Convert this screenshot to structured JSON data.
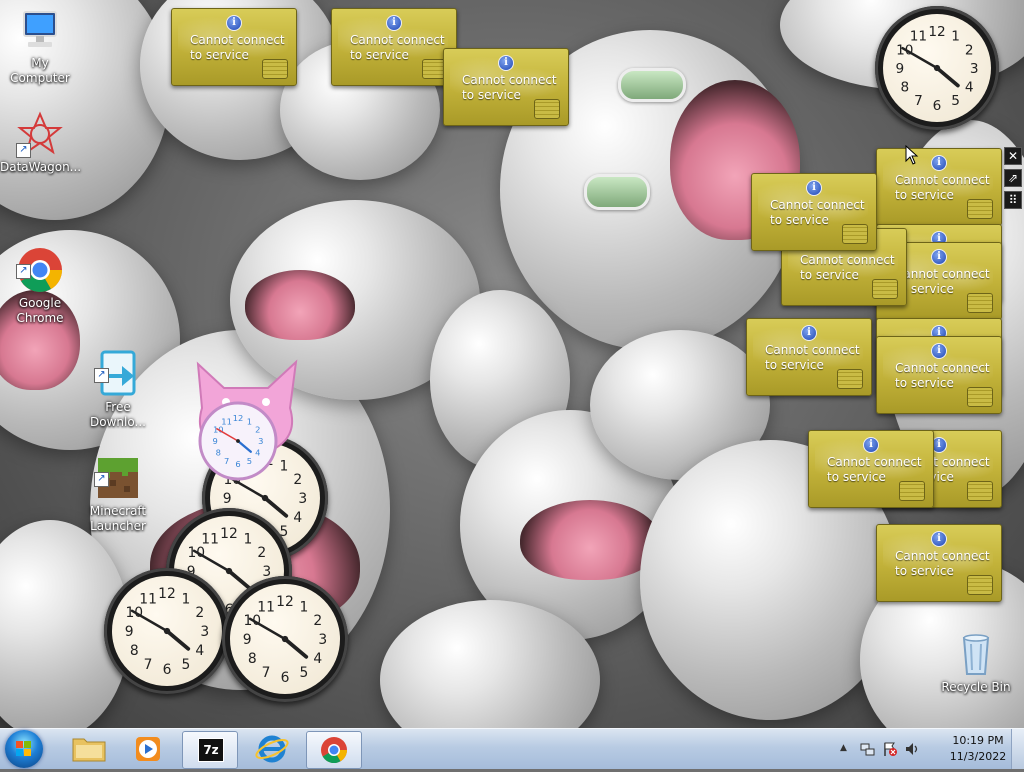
{
  "desktop_icons": [
    {
      "label": "My Computer",
      "icon": "computer-icon"
    },
    {
      "label": "DataWagon...",
      "icon": "datawagon-icon"
    },
    {
      "label": "Google\nChrome",
      "icon": "chrome-icon"
    },
    {
      "label": "Free\nDownlo...",
      "icon": "free-download-icon"
    },
    {
      "label": "Minecraft\nLauncher",
      "icon": "minecraft-icon"
    },
    {
      "label": "Recycle Bin",
      "icon": "recycle-bin-icon"
    }
  ],
  "alert_gadget": {
    "message_line1": "Cannot connect",
    "message_line2": "to service",
    "partial_text_a": "ce",
    "partial_text_b": "service",
    "info_glyph": "i"
  },
  "gadget_toolbar": {
    "close_glyph": "✕",
    "options_glyph": "⇗",
    "drag_glyph": "⠿"
  },
  "clock_numbers": [
    "12",
    "1",
    "2",
    "3",
    "4",
    "5",
    "6",
    "7",
    "8",
    "9",
    "10",
    "11"
  ],
  "taskbar": {
    "pinned": [
      "start-orb",
      "explorer",
      "media-player",
      "7zip",
      "internet-explorer",
      "chrome"
    ],
    "sevenzip_label": "7z",
    "time": "10:19 PM",
    "date": "11/3/2022",
    "tray_icons": [
      "show-hidden-icons",
      "network-icon",
      "action-center-flag-icon",
      "volume-icon"
    ],
    "tray_chevron": "▲"
  },
  "colors": {
    "gadget_yellow": "#c3b33a",
    "taskbar": "#b8cbe3",
    "wallpaper": "#6f6f6f"
  }
}
